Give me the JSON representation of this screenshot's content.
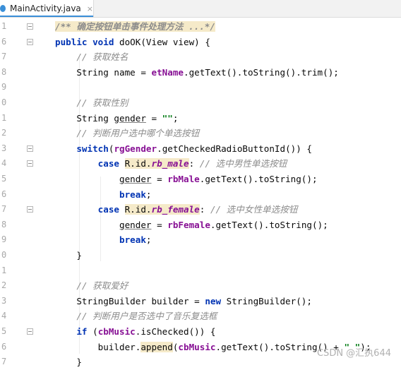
{
  "tab": {
    "label": "MainActivity.java",
    "close": "×"
  },
  "lines": [
    {
      "n": "1",
      "code": "/** 确定按钮单击事件处理方法 ...*/"
    },
    {
      "n": "6",
      "code": "public void doOK(View view) {"
    },
    {
      "n": "7",
      "code": "// 获取姓名"
    },
    {
      "n": "8",
      "code": "String name = etName.getText().toString().trim();"
    },
    {
      "n": "9",
      "code": ""
    },
    {
      "n": "0",
      "code": "// 获取性别"
    },
    {
      "n": "1",
      "code": "String gender = \"\";"
    },
    {
      "n": "2",
      "code": "// 判断用户选中哪个单选按钮"
    },
    {
      "n": "3",
      "code": "switch(rgGender.getCheckedRadioButtonId()) {"
    },
    {
      "n": "4",
      "code": "case R.id.rb_male: // 选中男性单选按钮"
    },
    {
      "n": "5",
      "code": "gender = rbMale.getText().toString();"
    },
    {
      "n": "6",
      "code": "break;"
    },
    {
      "n": "7",
      "code": "case R.id.rb_female: // 选中女性单选按钮"
    },
    {
      "n": "8",
      "code": "gender = rbFemale.getText().toString();"
    },
    {
      "n": "9",
      "code": "break;"
    },
    {
      "n": "0",
      "code": "}"
    },
    {
      "n": "1",
      "code": ""
    },
    {
      "n": "2",
      "code": "// 获取爱好"
    },
    {
      "n": "3",
      "code": "StringBuilder builder = new StringBuilder();"
    },
    {
      "n": "4",
      "code": "// 判断用户是否选中了音乐复选框"
    },
    {
      "n": "5",
      "code": "if (cbMusic.isChecked()) {"
    },
    {
      "n": "6",
      "code": "builder.append(cbMusic.getText().toString() + \" \");"
    },
    {
      "n": "7",
      "code": "}"
    }
  ],
  "watermark": "CSDN @汇执644",
  "colors": {
    "keyword": "#0033b3",
    "field": "#871094",
    "string": "#067d17",
    "comment": "#8c8c8c",
    "highlight": "#f5eac9",
    "tab_accent": "#3a8fd8"
  },
  "icons": [
    "java-file-icon",
    "close-icon",
    "fold-marker-icon"
  ]
}
